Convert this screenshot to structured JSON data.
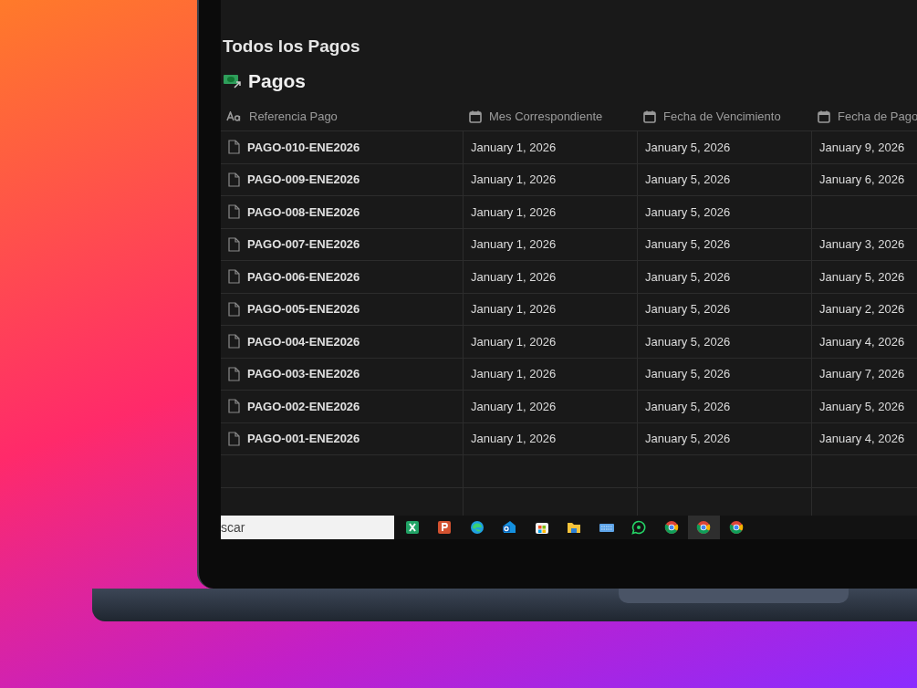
{
  "section_title": "Todos los Pagos",
  "database": {
    "title": "Pagos",
    "columns": [
      {
        "label": "Referencia Pago",
        "kind": "title"
      },
      {
        "label": "Mes Correspondiente",
        "kind": "date"
      },
      {
        "label": "Fecha de Vencimiento",
        "kind": "date"
      },
      {
        "label": "Fecha de Pago",
        "kind": "date"
      }
    ],
    "rows": [
      {
        "cells": [
          "PAGO-010-ENE2026",
          "January 1, 2026",
          "January 5, 2026",
          "January 9, 2026"
        ]
      },
      {
        "cells": [
          "PAGO-009-ENE2026",
          "January 1, 2026",
          "January 5, 2026",
          "January 6, 2026"
        ]
      },
      {
        "cells": [
          "PAGO-008-ENE2026",
          "January 1, 2026",
          "January 5, 2026"
        ]
      },
      {
        "cells": [
          "PAGO-007-ENE2026",
          "January 1, 2026",
          "January 5, 2026",
          "January 3, 2026"
        ]
      },
      {
        "cells": [
          "PAGO-006-ENE2026",
          "January 1, 2026",
          "January 5, 2026",
          "January 5, 2026"
        ]
      },
      {
        "cells": [
          "PAGO-005-ENE2026",
          "January 1, 2026",
          "January 5, 2026",
          "January 2, 2026"
        ]
      },
      {
        "cells": [
          "PAGO-004-ENE2026",
          "January 1, 2026",
          "January 5, 2026",
          "January 4, 2026"
        ]
      },
      {
        "cells": [
          "PAGO-003-ENE2026",
          "January 1, 2026",
          "January 5, 2026",
          "January 7, 2026"
        ]
      },
      {
        "cells": [
          "PAGO-002-ENE2026",
          "January 1, 2026",
          "January 5, 2026",
          "January 5, 2026"
        ]
      },
      {
        "cells": [
          "PAGO-001-ENE2026",
          "January 1, 2026",
          "January 5, 2026",
          "January 4, 2026"
        ]
      }
    ]
  },
  "taskbar": {
    "search": {
      "placeholder": "scar"
    },
    "apps": [
      {
        "kind": "excel",
        "selected": false
      },
      {
        "kind": "powerpoint",
        "selected": false
      },
      {
        "kind": "edge",
        "selected": false
      },
      {
        "kind": "outlook",
        "selected": false
      },
      {
        "kind": "store",
        "selected": false
      },
      {
        "kind": "folder",
        "selected": false
      },
      {
        "kind": "keyboard",
        "selected": false
      },
      {
        "kind": "whatsapp",
        "selected": false
      },
      {
        "kind": "chrome",
        "selected": false
      },
      {
        "kind": "chrome",
        "selected": true
      },
      {
        "kind": "chrome",
        "selected": false
      }
    ]
  }
}
